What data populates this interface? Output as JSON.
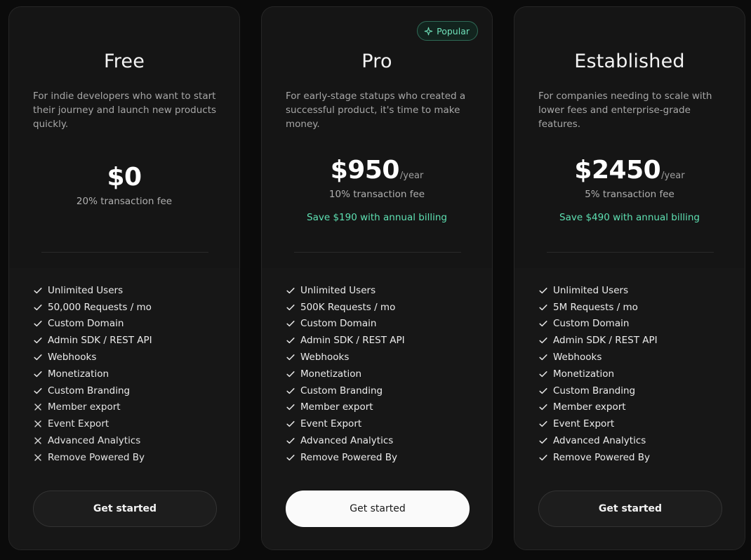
{
  "plans": [
    {
      "name": "Free",
      "description": "For indie developers who want to start their journey and launch new products quickly.",
      "price": "$0",
      "period": "",
      "fee": "20% transaction fee",
      "savings": "",
      "badge": "",
      "cta_label": "Get started",
      "features": [
        {
          "label": "Unlimited Users",
          "included": true
        },
        {
          "label": "50,000 Requests / mo",
          "included": true
        },
        {
          "label": "Custom Domain",
          "included": true
        },
        {
          "label": "Admin SDK / REST API",
          "included": true
        },
        {
          "label": "Webhooks",
          "included": true
        },
        {
          "label": "Monetization",
          "included": true
        },
        {
          "label": "Custom Branding",
          "included": true
        },
        {
          "label": "Member export",
          "included": false
        },
        {
          "label": "Event Export",
          "included": false
        },
        {
          "label": "Advanced Analytics",
          "included": false
        },
        {
          "label": "Remove Powered By",
          "included": false
        }
      ]
    },
    {
      "name": "Pro",
      "description": "For early-stage statups who created a successful product, it's time to make money.",
      "price": "$950",
      "period": "/year",
      "fee": "10% transaction fee",
      "savings": "Save $190 with annual billing",
      "badge": "Popular",
      "cta_label": "Get started",
      "features": [
        {
          "label": "Unlimited Users",
          "included": true
        },
        {
          "label": "500K Requests / mo",
          "included": true
        },
        {
          "label": "Custom Domain",
          "included": true
        },
        {
          "label": "Admin SDK / REST API",
          "included": true
        },
        {
          "label": "Webhooks",
          "included": true
        },
        {
          "label": "Monetization",
          "included": true
        },
        {
          "label": "Custom Branding",
          "included": true
        },
        {
          "label": "Member export",
          "included": true
        },
        {
          "label": "Event Export",
          "included": true
        },
        {
          "label": "Advanced Analytics",
          "included": true
        },
        {
          "label": "Remove Powered By",
          "included": true
        }
      ]
    },
    {
      "name": "Established",
      "description": "For companies needing to scale with lower fees and enterprise-grade features.",
      "price": "$2450",
      "period": "/year",
      "fee": "5% transaction fee",
      "savings": "Save $490 with annual billing",
      "badge": "",
      "cta_label": "Get started",
      "features": [
        {
          "label": "Unlimited Users",
          "included": true
        },
        {
          "label": "5M Requests / mo",
          "included": true
        },
        {
          "label": "Custom Domain",
          "included": true
        },
        {
          "label": "Admin SDK / REST API",
          "included": true
        },
        {
          "label": "Webhooks",
          "included": true
        },
        {
          "label": "Monetization",
          "included": true
        },
        {
          "label": "Custom Branding",
          "included": true
        },
        {
          "label": "Member export",
          "included": true
        },
        {
          "label": "Event Export",
          "included": true
        },
        {
          "label": "Advanced Analytics",
          "included": true
        },
        {
          "label": "Remove Powered By",
          "included": true
        }
      ]
    }
  ],
  "icons": {
    "included": "check-icon",
    "excluded": "x-icon",
    "badge": "sparkle-icon"
  },
  "colors": {
    "background": "#0b0b0b",
    "card": "#151515",
    "accent": "#5ee0b2",
    "primary_button": "#fafafa"
  }
}
